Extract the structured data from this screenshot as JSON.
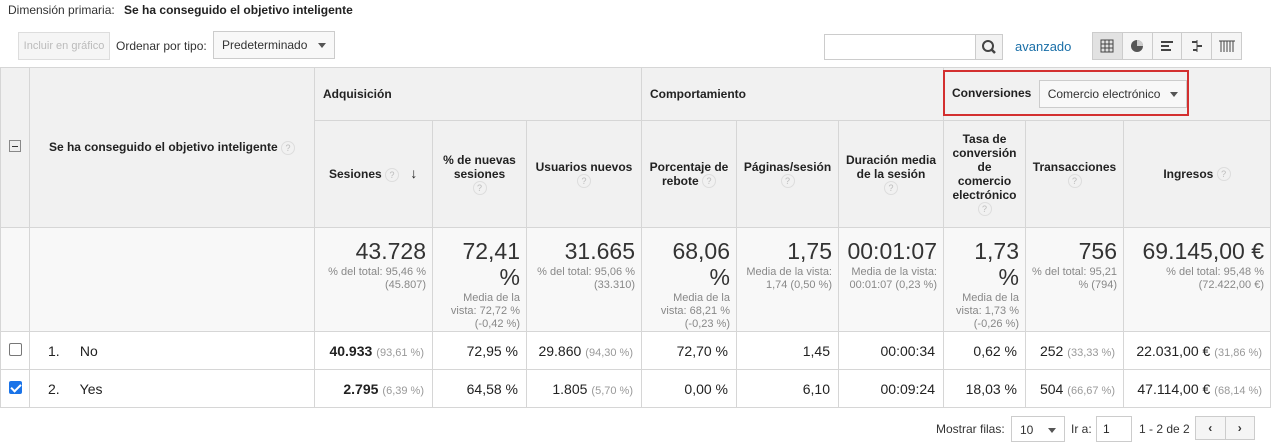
{
  "primary_dimension": {
    "label": "Dimensión primaria:",
    "value": "Se ha conseguido el objetivo inteligente"
  },
  "toolbar": {
    "plot_button": "Incluir en gráfico",
    "sort_label": "Ordenar por tipo:",
    "sort_value": "Predeterminado",
    "search_value": "",
    "advanced_link": "avanzado",
    "view_icons": [
      "table-view-icon",
      "pie-view-icon",
      "performance-view-icon",
      "comparison-view-icon",
      "pivot-view-icon"
    ]
  },
  "table": {
    "dimension_header": "Se ha conseguido el objetivo inteligente",
    "groups": {
      "acquisition": "Adquisición",
      "behavior": "Comportamiento",
      "conversions": "Conversiones",
      "conversions_select": "Comercio electrónico"
    },
    "columns": [
      "Sesiones",
      "% de nuevas sesiones",
      "Usuarios nuevos",
      "Porcentaje de rebote",
      "Páginas/sesión",
      "Duración media de la sesión",
      "Tasa de conversión de comercio electrónico",
      "Transacciones",
      "Ingresos"
    ],
    "totals": [
      {
        "value": "43.728",
        "sub": "% del total: 95,46 % (45.807)"
      },
      {
        "value": "72,41 %",
        "sub": "Media de la vista: 72,72 % (-0,42 %)"
      },
      {
        "value": "31.665",
        "sub": "% del total: 95,06 % (33.310)"
      },
      {
        "value": "68,06 %",
        "sub": "Media de la vista: 68,21 % (-0,23 %)"
      },
      {
        "value": "1,75",
        "sub": "Media de la vista: 1,74 (0,50 %)"
      },
      {
        "value": "00:01:07",
        "sub": "Media de la vista: 00:01:07 (0,23 %)"
      },
      {
        "value": "1,73 %",
        "sub": "Media de la vista: 1,73 % (-0,26 %)"
      },
      {
        "value": "756",
        "sub": "% del total: 95,21 % (794)"
      },
      {
        "value": "69.145,00 €",
        "sub": "% del total: 95,48 % (72.422,00 €)"
      }
    ],
    "rows": [
      {
        "index": "1.",
        "label": "No",
        "checked": false,
        "sessions": "40.933",
        "sessions_pct": "(93,61 %)",
        "new_sessions_pct": "72,95 %",
        "new_users": "29.860",
        "new_users_pct": "(94,30 %)",
        "bounce": "72,70 %",
        "pages": "1,45",
        "duration": "00:00:34",
        "conv_rate": "0,62 %",
        "transactions": "252",
        "transactions_pct": "(33,33 %)",
        "revenue": "22.031,00 €",
        "revenue_pct": "(31,86 %)"
      },
      {
        "index": "2.",
        "label": "Yes",
        "checked": true,
        "sessions": "2.795",
        "sessions_pct": "(6,39 %)",
        "new_sessions_pct": "64,58 %",
        "new_users": "1.805",
        "new_users_pct": "(5,70 %)",
        "bounce": "0,00 %",
        "pages": "6,10",
        "duration": "00:09:24",
        "conv_rate": "18,03 %",
        "transactions": "504",
        "transactions_pct": "(66,67 %)",
        "revenue": "47.114,00 €",
        "revenue_pct": "(68,14 %)"
      }
    ]
  },
  "pagination": {
    "rows_label": "Mostrar filas:",
    "rows_value": "10",
    "goto_label": "Ir a:",
    "goto_value": "1",
    "range": "1 - 2 de 2",
    "prev": "‹",
    "next": "›"
  }
}
